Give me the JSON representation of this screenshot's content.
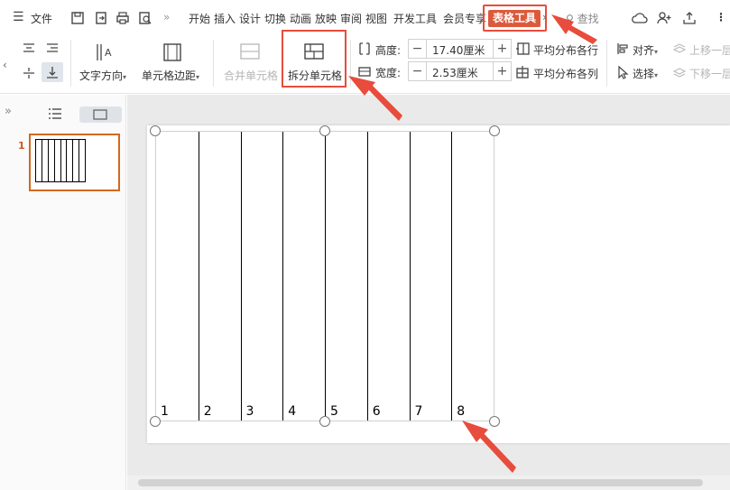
{
  "menubar": {
    "file": "文件",
    "tabs": [
      "开始",
      "插入",
      "设计",
      "切换",
      "动画",
      "放映",
      "审阅",
      "视图",
      "开发工具",
      "会员专享"
    ],
    "active_tab": "表格工具",
    "search": "查找"
  },
  "ribbon": {
    "text_direction": "文字方向",
    "cell_margin": "单元格边距",
    "merge_cells": "合并单元格",
    "split_cells": "拆分单元格",
    "height_label": "高度:",
    "height_value": "17.40厘米",
    "width_label": "宽度:",
    "width_value": "2.53厘米",
    "distribute_rows": "平均分布各行",
    "distribute_cols": "平均分布各列",
    "align": "对齐",
    "select": "选择",
    "move_up": "上移一层",
    "move_down": "下移一层"
  },
  "slides_panel": {
    "slide_number": "1"
  },
  "table": {
    "cells": [
      "1",
      "2",
      "3",
      "4",
      "5",
      "6",
      "7",
      "8"
    ]
  },
  "colors": {
    "accent": "#dc5a3c",
    "highlight_border": "#e74c3c",
    "thumb_border": "#d2691e"
  }
}
